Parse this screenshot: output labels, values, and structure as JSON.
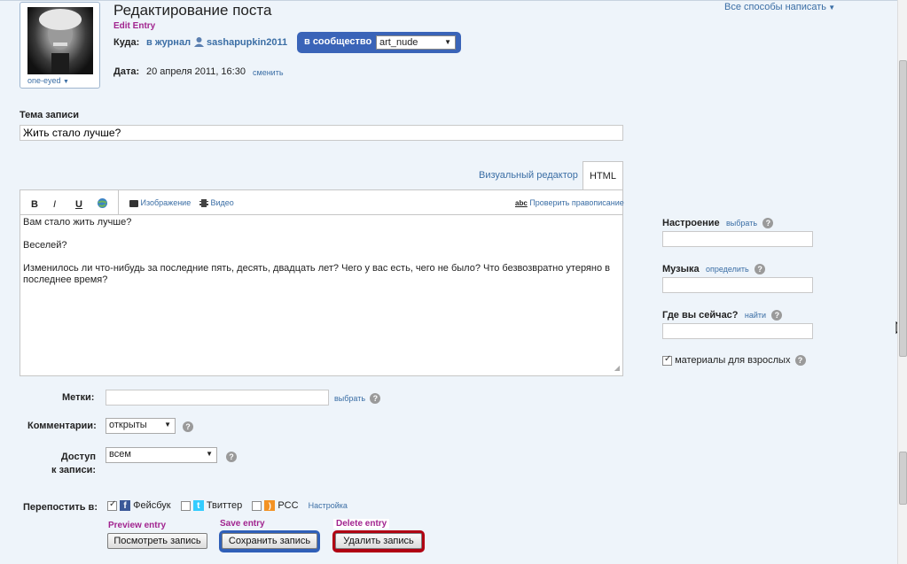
{
  "header": {
    "title": "Редактирование поста",
    "subtitle": "Edit Entry",
    "all_ways": "Все способы написать"
  },
  "userpic": {
    "username": "one-eyed"
  },
  "where": {
    "label": "Куда:",
    "journal_link": "в журнал",
    "username": "sashapupkin2011",
    "community_label": "в сообщество",
    "community_value": "art_nude"
  },
  "date": {
    "label": "Дата:",
    "value": "20 апреля 2011, 16:30",
    "change_link": "сменить"
  },
  "subject": {
    "label": "Тема записи",
    "value": "Жить стало лучше?"
  },
  "editor_tabs": {
    "visual": "Визуальный редактор",
    "html": "HTML"
  },
  "toolbar": {
    "bold": "B",
    "italic": "I",
    "underline": "U",
    "image": "Изображение",
    "video": "Видео",
    "spellcheck_prefix": "abc",
    "spellcheck": "Проверить правописание"
  },
  "body_text": {
    "line1": "Вам стало жить лучше?",
    "line2": "Веселей?",
    "line3": "Изменилось ли что-нибудь за последние пять, десять, двадцать лет? Чего у вас есть, чего не было? Что безвозвратно утеряно в последнее время?"
  },
  "side": {
    "mood_label": "Настроение",
    "mood_link": "выбрать",
    "music_label": "Музыка",
    "music_link": "определить",
    "location_label": "Где вы сейчас?",
    "location_link": "найти",
    "adult_label": "материалы для взрослых",
    "adult_checked": true
  },
  "tags": {
    "label": "Метки:",
    "link": "выбрать",
    "value": ""
  },
  "comments": {
    "label": "Комментарии:",
    "value": "открыты"
  },
  "access": {
    "label_line1": "Доступ",
    "label_line2": "к записи:",
    "value": "всем"
  },
  "crosspost": {
    "label": "Перепостить в:",
    "facebook": "Фейсбук",
    "facebook_checked": true,
    "twitter": "Твиттер",
    "twitter_checked": false,
    "rss": "РСС",
    "rss_checked": false,
    "settings": "Настройка"
  },
  "actions": {
    "preview_hint": "Preview entry",
    "preview": "Посмотреть запись",
    "save_hint": "Save entry",
    "save": "Сохранить запись",
    "delete_hint": "Delete entry",
    "delete": "Удалить запись"
  },
  "colors": {
    "community_bg": "#3a64b8",
    "save_frame": "#2f5fb8",
    "delete_frame": "#b00012",
    "annotation": "#a1248f"
  }
}
